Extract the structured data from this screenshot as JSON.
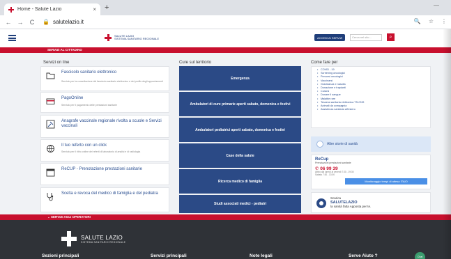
{
  "browser": {
    "tab_title": "Home - Salute Lazio",
    "tab_close": "×",
    "new_tab": "+",
    "url": "salutelazio.it",
    "min": "—",
    "nav_back": "←",
    "nav_forward": "→",
    "nav_reload": "C",
    "lock": "🔒",
    "zoom": "🔍",
    "star": "☆",
    "menu": "⋮"
  },
  "header": {
    "logo_line1": "SALUTE LAZIO",
    "logo_line2": "SISTEMA SANITARIO REGIONALE",
    "accedi": "ACCEDI AI SERVIZI",
    "search_placeholder": "Cerca nel sito...",
    "search_icon": "⌕"
  },
  "section_bar": "SERVIZI AL CITTADINO",
  "servizi_online": {
    "title": "Servizi on line",
    "items": [
      {
        "title": "Fascicolo sanitario elettronico",
        "desc": "Servizio per la consultazione del fascicolo sanitario elettronico e del profilo degli appuntamenti",
        "icon": "folder-icon"
      },
      {
        "title": "PagoOnline",
        "desc": "Servizio per il pagamento delle prestazioni sanitarie",
        "icon": "card-icon"
      },
      {
        "title": "Anagrafe vaccinale regionale rivolta a scuole e Servizi vaccinali",
        "desc": "",
        "icon": "vaccine-icon"
      },
      {
        "title": "Il tuo referto con un click",
        "desc": "Servizio per il ritiro online dei referti di laboratorio di analisi e di radiologia",
        "icon": "globe-icon"
      },
      {
        "title": "ReCUP - Prenotazione prestazioni sanitarie",
        "desc": "",
        "icon": "calendar-icon"
      },
      {
        "title": "Scelta e revoca del medico di famiglia e del pediatra",
        "desc": "",
        "icon": "stethoscope-icon"
      }
    ]
  },
  "territorio": {
    "title": "Cure sul territorio",
    "buttons": [
      "Emergenza",
      "Ambulatori di cure primarie aperti sabato, domenica e festivi",
      "Ambulatori pediatrici aperti sabato, domenica e festivi",
      "Case della salute",
      "Ricerca medico di famiglia",
      "Studi associati medici - pediatri"
    ]
  },
  "come_fare": {
    "title": "Come fare per",
    "items": [
      "COVID - 19",
      "Screening oncologici",
      "Percorsi oncologici",
      "Vaccinarsi",
      "Gravidanza e nascita",
      "Donazione e trapianti",
      "Curarsi",
      "Donare il sangue",
      "Malattie rare",
      "Tessera sanitaria elettronica TS-CNS",
      "Animali da compagnia",
      "Assistenza sanitaria all'estero"
    ]
  },
  "altre_storie": "Altre storie di sanità",
  "recup": {
    "title": "ReCup",
    "subtitle": "Prenotazioni prestazioni sanitarie",
    "phone": "06 99 39",
    "hours1": "Attivo dal lunedì al venerdì 7:30 - 19:30",
    "hours2": "Sabato 7:30 - 13:00",
    "button": "Monitoraggio tempi di attesa ITAIO"
  },
  "scarica": {
    "line1": "Scarica",
    "line2": "SALUTELAZIO",
    "line3": "la sanità fatta Apposta per te."
  },
  "section_bar2": "SERVIZI AGLI OPERATORI",
  "footer": {
    "logo_name": "SALUTE LAZIO",
    "logo_sub": "SISTEMA SANITARIO REGIONALE",
    "cols": [
      "Sezioni principali",
      "Servizi principali",
      "Note legali",
      "Serve Aiuto ?"
    ],
    "chat": "Chat"
  },
  "colors": {
    "brand_red": "#c8102e",
    "brand_blue": "#2b4a86",
    "footer": "#2f3237"
  }
}
